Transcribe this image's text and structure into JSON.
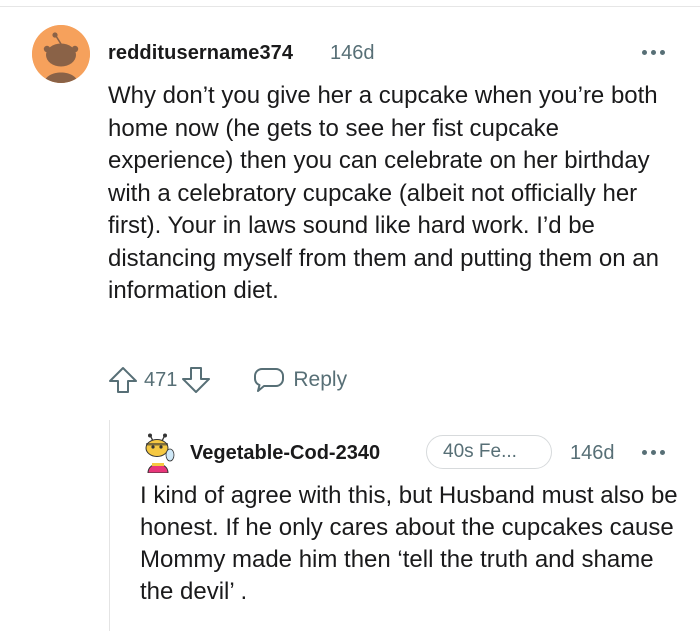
{
  "comment": {
    "username": "redditusername374",
    "age": "146d",
    "body": "Why don’t you give her a cupcake when you’re both home now (he gets to see her fist cupcake experience) then you can celebrate on her birthday with a celebratory cupcake (albeit not officially her first). Your in laws sound like hard work. I’d be distancing myself from them and putting them on an information diet.",
    "votes": "471",
    "reply_label": "Reply",
    "avatar_color": "#f6a15c"
  },
  "reply": {
    "username": "Vegetable-Cod-2340",
    "flair": "40s Fe...",
    "age": "146d",
    "body": "I kind of agree with this, but Husband must also be honest. If he only cares about the cupcakes cause Mommy made him then ‘tell the truth and shame the devil’ ."
  },
  "icons": {
    "more": "more-options-icon",
    "upvote": "upvote-arrow-icon",
    "downvote": "downvote-arrow-icon",
    "reply": "speech-bubble-icon"
  },
  "colors": {
    "text": "#1a1a1b",
    "meta": "#576f76"
  }
}
